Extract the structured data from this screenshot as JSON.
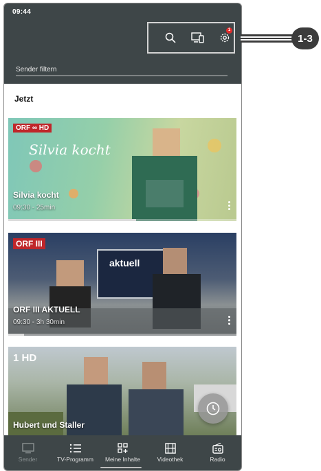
{
  "status_bar": {
    "time": "09:44"
  },
  "toolbar": {
    "search_icon": "search-icon",
    "cast_icon": "devices-icon",
    "settings_icon": "gear-icon",
    "settings_badge": "1"
  },
  "filter": {
    "placeholder": "Sender filtern"
  },
  "section": {
    "title": "Jetzt"
  },
  "cards": [
    {
      "channel": "ORF ∞ HD",
      "overlay": "Silvia kocht",
      "title": "Silvia kocht",
      "subtitle": "09:30 - 25min",
      "progress": 0.56
    },
    {
      "channel": "ORF III",
      "overlay": "aktuell",
      "title": "ORF III AKTUELL",
      "subtitle": "09:30 - 3h 30min",
      "progress": 0.07
    },
    {
      "channel": "1 HD",
      "overlay": "",
      "title": "Hubert und Staller",
      "subtitle": "",
      "progress": 0
    }
  ],
  "nav": {
    "items": [
      {
        "label": "Sender",
        "icon": "tv-icon",
        "active": true
      },
      {
        "label": "TV-Programm",
        "icon": "list-icon",
        "active": false
      },
      {
        "label": "Meine Inhalte",
        "icon": "grid-plus-icon",
        "active": false
      },
      {
        "label": "Videothek",
        "icon": "film-icon",
        "active": false
      },
      {
        "label": "Radio",
        "icon": "radio-icon",
        "active": false
      }
    ]
  },
  "annotation": {
    "label": "1-3"
  },
  "colors": {
    "bar": "#3e4648",
    "badge": "#e32b2b"
  }
}
